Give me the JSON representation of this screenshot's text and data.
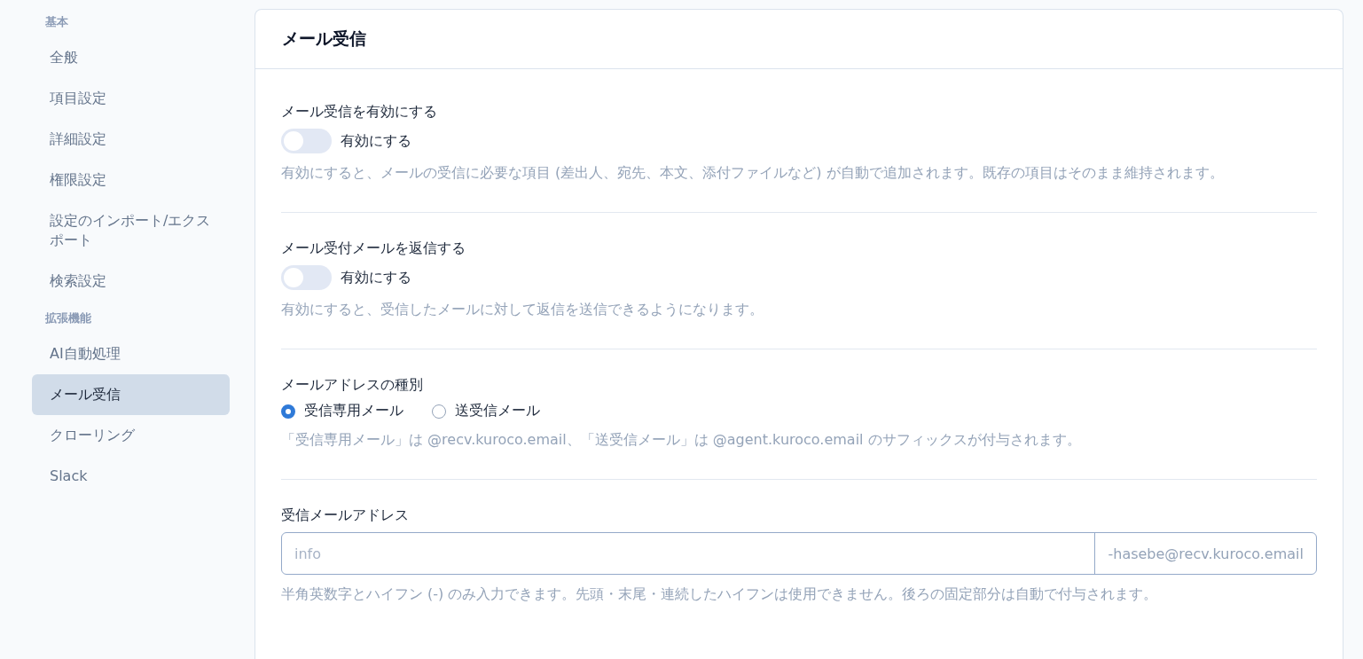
{
  "sidebar": {
    "groups": [
      {
        "heading": "基本",
        "items": [
          {
            "label": "全般",
            "selected": false
          },
          {
            "label": "項目設定",
            "selected": false
          },
          {
            "label": "詳細設定",
            "selected": false
          },
          {
            "label": "権限設定",
            "selected": false
          },
          {
            "label": "設定のインポート/エクスポート",
            "selected": false
          },
          {
            "label": "検索設定",
            "selected": false
          }
        ]
      },
      {
        "heading": "拡張機能",
        "items": [
          {
            "label": "AI自動処理",
            "selected": false
          },
          {
            "label": "メール受信",
            "selected": true
          },
          {
            "label": "クローリング",
            "selected": false
          },
          {
            "label": "Slack",
            "selected": false
          }
        ]
      }
    ]
  },
  "panel": {
    "title": "メール受信",
    "sections": [
      {
        "kind": "toggle",
        "label": "メール受信を有効にする",
        "toggle_label": "有効にする",
        "on": false,
        "help": "有効にすると、メールの受信に必要な項目 (差出人、宛先、本文、添付ファイルなど) が自動で追加されます。既存の項目はそのまま維持されます。"
      },
      {
        "kind": "toggle",
        "label": "メール受付メールを返信する",
        "toggle_label": "有効にする",
        "on": false,
        "help": "有効にすると、受信したメールに対して返信を送信できるようになります。"
      },
      {
        "kind": "radio",
        "label": "メールアドレスの種別",
        "options": [
          {
            "label": "受信専用メール",
            "selected": true
          },
          {
            "label": "送受信メール",
            "selected": false
          }
        ],
        "help": "「受信専用メール」は @recv.kuroco.email、「送受信メール」は @agent.kuroco.email のサフィックスが付与されます。"
      },
      {
        "kind": "input",
        "label": "受信メールアドレス",
        "placeholder": "info",
        "suffix": "-hasebe@recv.kuroco.email",
        "help": "半角英数字とハイフン (-) のみ入力できます。先頭・末尾・連続したハイフンは使用できません。後ろの固定部分は自動で付与されます。"
      }
    ]
  }
}
